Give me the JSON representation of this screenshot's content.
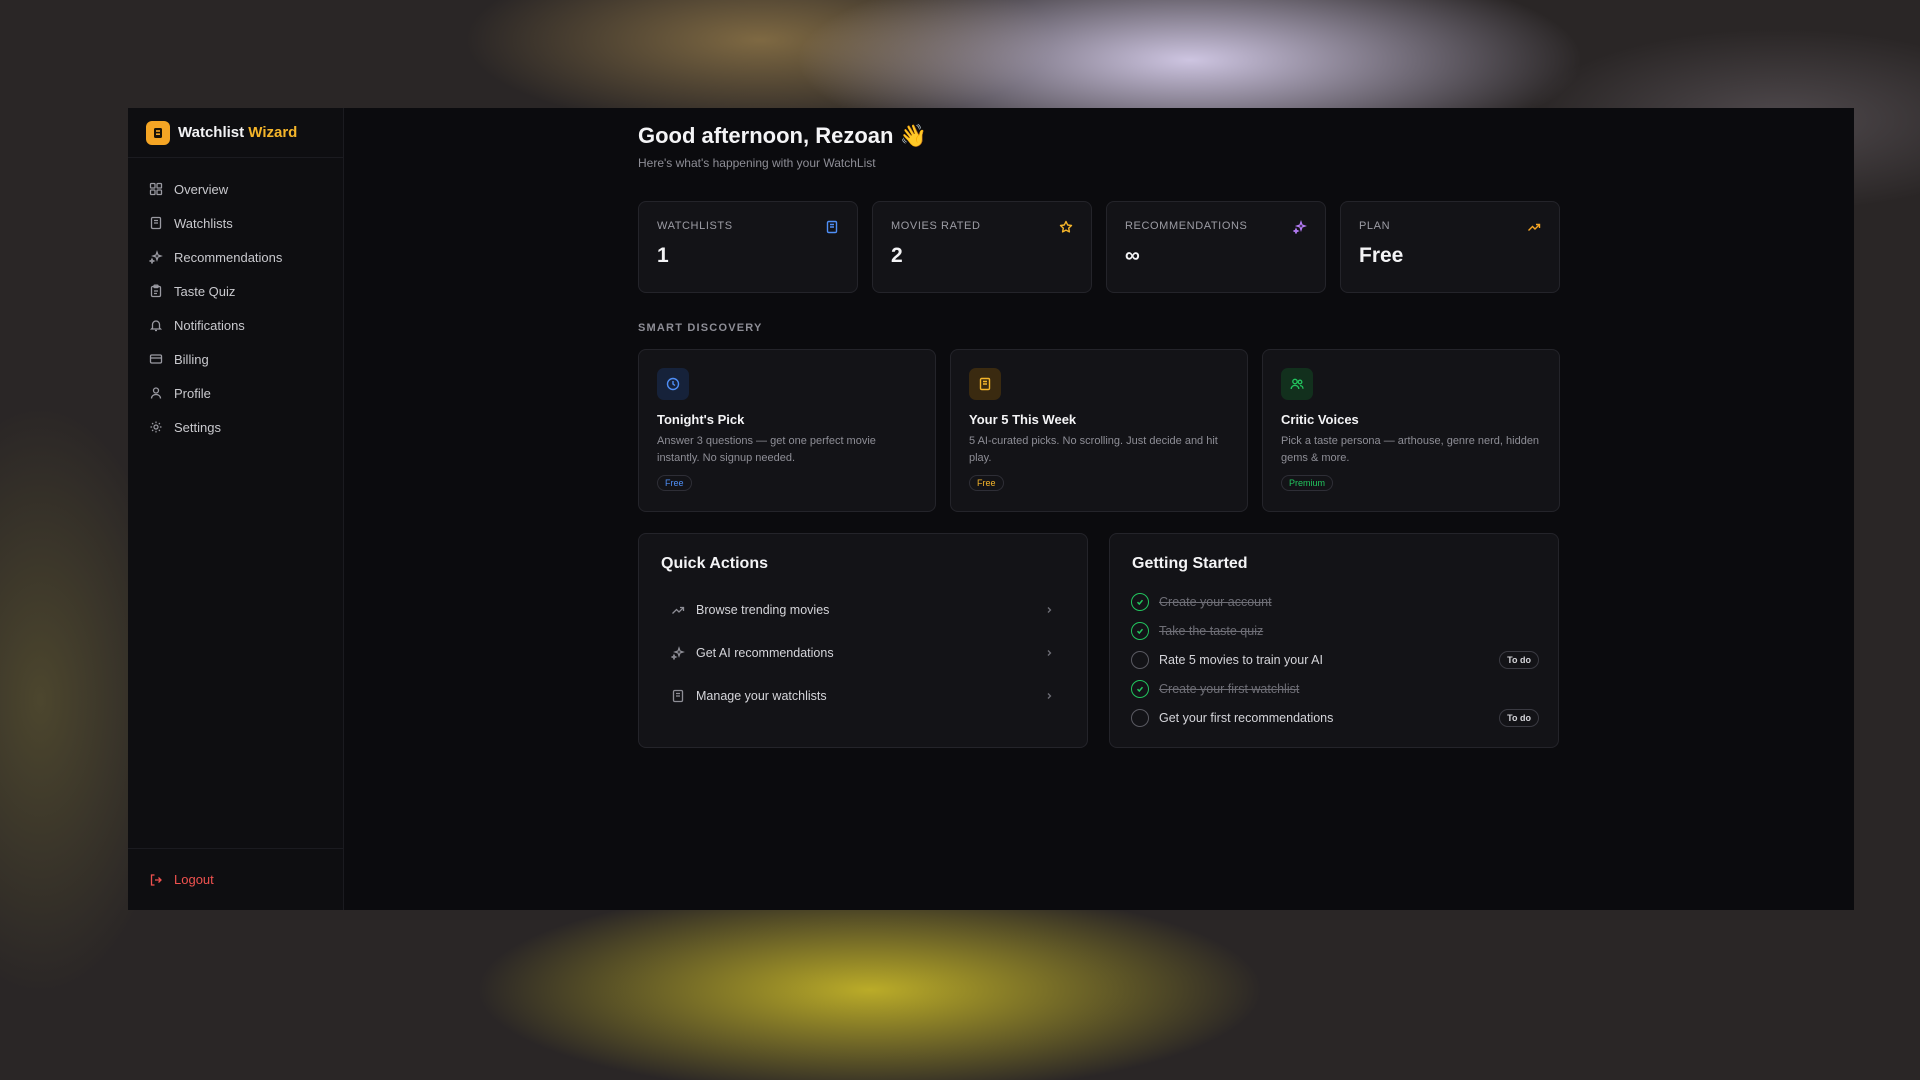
{
  "brand": {
    "name": "Watchlist",
    "accent": "Wizard"
  },
  "sidebar": {
    "items": [
      {
        "label": "Overview",
        "icon": "grid-icon"
      },
      {
        "label": "Watchlists",
        "icon": "bookmark-icon"
      },
      {
        "label": "Recommendations",
        "icon": "sparkles-icon"
      },
      {
        "label": "Taste Quiz",
        "icon": "clipboard-icon"
      },
      {
        "label": "Notifications",
        "icon": "bell-icon"
      },
      {
        "label": "Billing",
        "icon": "credit-card-icon"
      },
      {
        "label": "Profile",
        "icon": "user-icon"
      },
      {
        "label": "Settings",
        "icon": "gear-icon"
      }
    ],
    "logout": "Logout"
  },
  "header": {
    "greeting": "Good afternoon, Rezoan 👋",
    "subtitle": "Here's what's happening with your WatchList"
  },
  "stats": [
    {
      "label": "WATCHLISTS",
      "value": "1",
      "icon": "bookmark-icon",
      "color": "#4f8ff7"
    },
    {
      "label": "MOVIES RATED",
      "value": "2",
      "icon": "star-icon",
      "color": "#f5b52a"
    },
    {
      "label": "RECOMMENDATIONS",
      "value": "∞",
      "icon": "sparkles-icon",
      "color": "#b57cf7"
    },
    {
      "label": "PLAN",
      "value": "Free",
      "icon": "trending-up-icon",
      "color": "#f5a524"
    }
  ],
  "discovery": {
    "section_label": "SMART DISCOVERY",
    "cards": [
      {
        "title": "Tonight's Pick",
        "desc": "Answer 3 questions — get one perfect movie instantly. No signup needed.",
        "badge": "Free",
        "icon": "clock-icon",
        "color": "#4f8ff7"
      },
      {
        "title": "Your 5 This Week",
        "desc": "5 AI-curated picks. No scrolling. Just decide and hit play.",
        "badge": "Free",
        "icon": "bookmark-icon",
        "color": "#f5b52a"
      },
      {
        "title": "Critic Voices",
        "desc": "Pick a taste persona — arthouse, genre nerd, hidden gems & more.",
        "badge": "Premium",
        "icon": "users-icon",
        "color": "#22c55e"
      }
    ]
  },
  "quick_actions": {
    "title": "Quick Actions",
    "items": [
      {
        "label": "Browse trending movies",
        "icon": "trending-up-icon"
      },
      {
        "label": "Get AI recommendations",
        "icon": "sparkles-icon"
      },
      {
        "label": "Manage your watchlists",
        "icon": "bookmark-icon"
      }
    ]
  },
  "getting_started": {
    "title": "Getting Started",
    "todo_label": "To do",
    "items": [
      {
        "label": "Create your account",
        "done": true
      },
      {
        "label": "Take the taste quiz",
        "done": true
      },
      {
        "label": "Rate 5 movies to train your AI",
        "done": false
      },
      {
        "label": "Create your first watchlist",
        "done": true
      },
      {
        "label": "Get your first recommendations",
        "done": false
      }
    ]
  }
}
